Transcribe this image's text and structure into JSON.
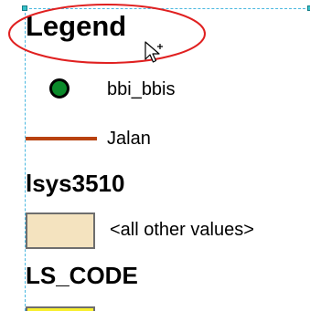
{
  "legend": {
    "title": "Legend",
    "items": [
      {
        "label": "bbi_bbis",
        "symbol": "green-dot-icon",
        "color": "#0a8a2a"
      },
      {
        "label": "Jalan",
        "symbol": "line-icon",
        "color": "#b8420f"
      }
    ],
    "layers": [
      {
        "heading": "lsys3510",
        "entries": [
          {
            "label": "<all other values>",
            "fill": "#f4e3bf"
          }
        ]
      },
      {
        "heading": "LS_CODE",
        "entries": [
          {
            "label": "",
            "fill": "#f8ef2e"
          }
        ]
      }
    ]
  },
  "colors": {
    "selection": "#4ab8e0",
    "highlight_ellipse": "#e02020"
  },
  "cursor": {
    "icon": "move-pointer-icon"
  }
}
